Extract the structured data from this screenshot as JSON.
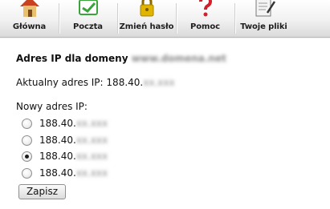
{
  "toolbar": {
    "items": [
      {
        "label": "Główna",
        "icon": "home-icon"
      },
      {
        "label": "Poczta",
        "icon": "mail-icon"
      },
      {
        "label": "Zmień hasło",
        "icon": "lock-icon"
      },
      {
        "label": "Pomoc",
        "icon": "help-icon"
      },
      {
        "label": "Twoje pliki",
        "icon": "files-icon"
      }
    ]
  },
  "page": {
    "title_prefix": "Adres IP dla domeny",
    "domain_blurred": "www.domena.net",
    "current_label": "Aktualny adres IP:",
    "current_ip_visible": "188.40.",
    "current_ip_blurred": "xx.xxx",
    "new_ip_label": "Nowy adres IP:"
  },
  "ip_options": [
    {
      "visible": "188.40.",
      "blurred": "xx.xxx",
      "checked": false
    },
    {
      "visible": "188.40.",
      "blurred": "xx.xxx",
      "checked": false
    },
    {
      "visible": "188.40.",
      "blurred": "xx.xxx",
      "checked": true
    },
    {
      "visible": "188.40.",
      "blurred": "xx.xxx",
      "checked": false
    }
  ],
  "save_label": "Zapisz",
  "colors": {
    "icon_red": "#c0392b",
    "icon_green": "#3aa33a",
    "icon_gold": "#e0b400"
  }
}
